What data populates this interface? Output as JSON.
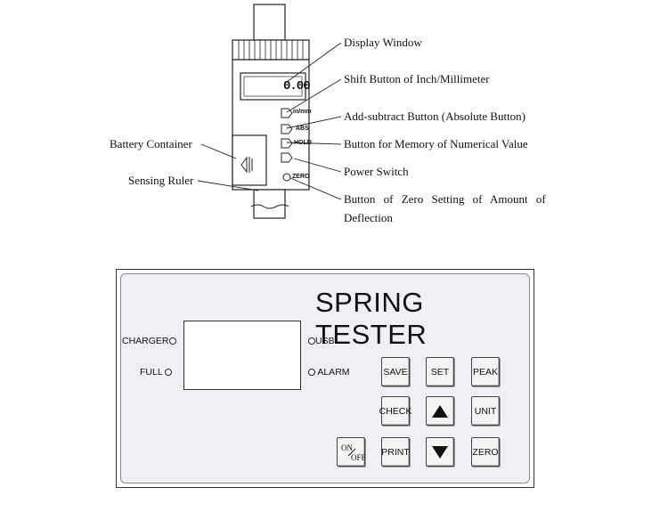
{
  "diagram": {
    "display_reading": "0.00",
    "device_buttons": [
      "in/mm",
      "ABS",
      "HOLD",
      "ZERO"
    ],
    "callouts_right": [
      "Display Window",
      "Shift Button of Inch/Millimeter",
      "Add-subtract Button (Absolute Button)",
      "Button for Memory of Numerical Value",
      "Power Switch",
      "Button of Zero Setting of Amount of",
      "Deflection"
    ],
    "callouts_left": [
      "Battery Container",
      "Sensing Ruler"
    ]
  },
  "panel": {
    "title": "SPRING TESTER",
    "indicators": {
      "charger": "CHARGER",
      "full": "FULL",
      "usb": "USB",
      "alarm": "ALARM"
    },
    "buttons": {
      "save": "SAVE",
      "set": "SET",
      "peak": "PEAK",
      "check": "CHECK",
      "unit": "UNIT",
      "print": "PRINT",
      "zero": "ZERO",
      "on": "ON",
      "off": "OFF"
    }
  }
}
